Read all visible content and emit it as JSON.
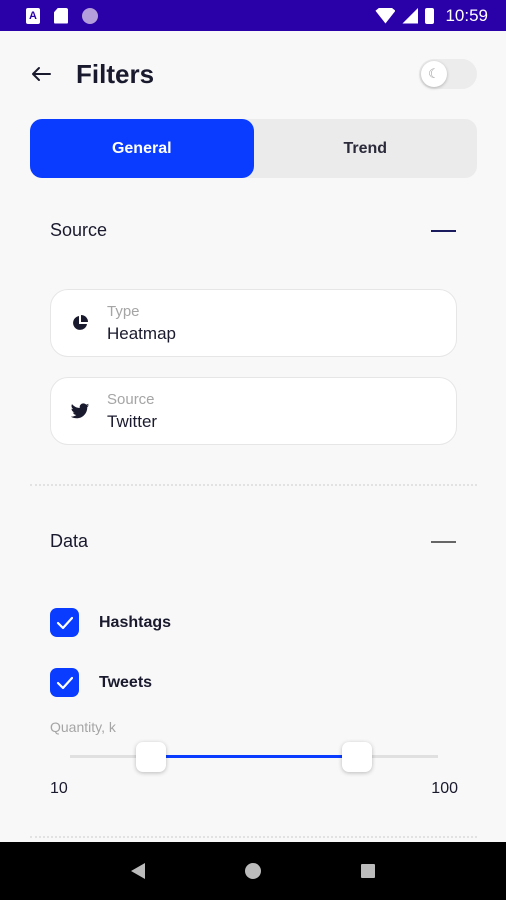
{
  "status_bar": {
    "time": "10:59",
    "notification_icons": [
      "a-icon",
      "sd-card-icon",
      "circle-icon"
    ]
  },
  "header": {
    "title": "Filters",
    "back_icon": "arrow-left-icon",
    "toggle_icon": "moon-icon"
  },
  "tabs": [
    {
      "label": "General",
      "active": true
    },
    {
      "label": "Trend",
      "active": false
    }
  ],
  "source_section": {
    "title": "Source",
    "fields": [
      {
        "label": "Type",
        "value": "Heatmap",
        "icon": "pie-chart-icon"
      },
      {
        "label": "Source",
        "value": "Twitter",
        "icon": "twitter-icon"
      }
    ]
  },
  "data_section": {
    "title": "Data",
    "checkboxes": [
      {
        "label": "Hashtags",
        "checked": true
      },
      {
        "label": "Tweets",
        "checked": true
      }
    ],
    "quantity": {
      "label": "Quantity, k",
      "min_label": "10",
      "max_label": "100",
      "range_start": 0.22,
      "range_end": 0.78
    }
  },
  "colors": {
    "accent": "#0a3cff",
    "status_bar": "#2a00a8"
  }
}
